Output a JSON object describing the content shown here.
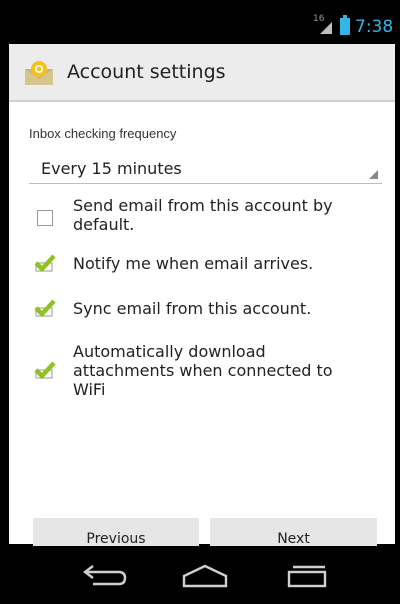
{
  "status_bar": {
    "signal_label": "16",
    "clock": "7:38"
  },
  "action_bar": {
    "icon": "mail-envelope-icon",
    "title": "Account settings"
  },
  "inbox_frequency": {
    "label": "Inbox checking frequency",
    "selected": "Every 15 minutes"
  },
  "preferences": [
    {
      "label_lines": [
        "Send email from this account by",
        "default."
      ],
      "checked": false
    },
    {
      "label_lines": [
        "Notify me when email arrives."
      ],
      "checked": true
    },
    {
      "label_lines": [
        "Sync email from this account."
      ],
      "checked": true
    },
    {
      "label_lines": [
        "Automatically download",
        "attachments when connected to",
        "WiFi"
      ],
      "checked": true
    }
  ],
  "buttons": {
    "previous": "Previous",
    "next": "Next"
  },
  "nav": {
    "back_icon": "back-icon",
    "home_icon": "home-icon",
    "recents_icon": "recent-apps-icon"
  },
  "colors": {
    "accent": "#33b5e5",
    "check": "#8fc31f"
  }
}
